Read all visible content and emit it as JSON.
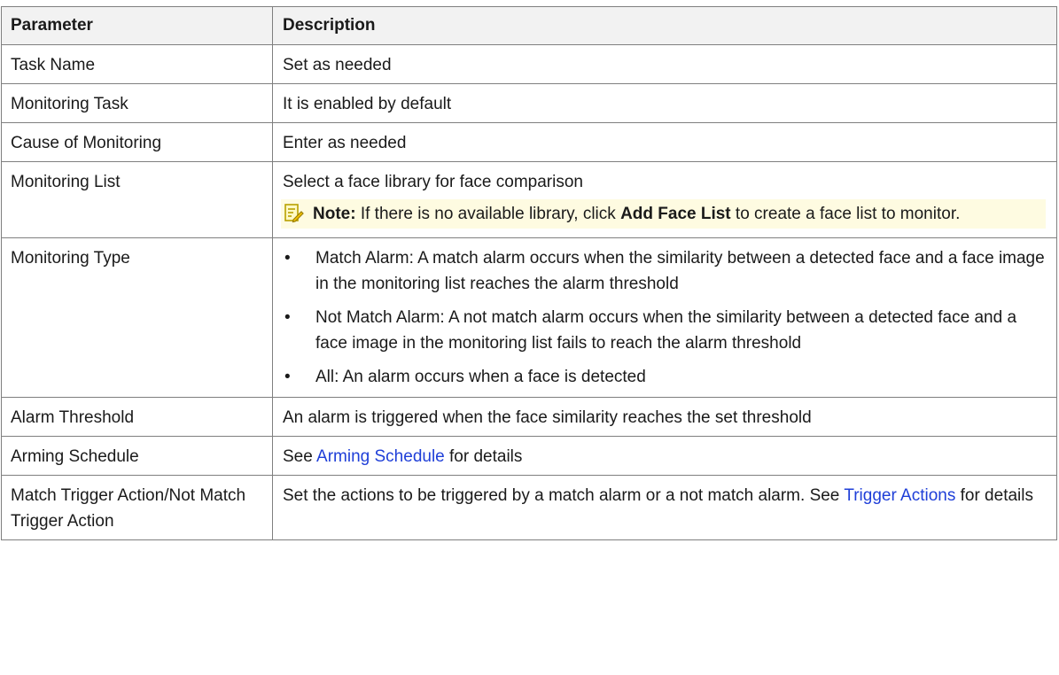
{
  "header": {
    "col1": "Parameter",
    "col2": "Description"
  },
  "rows": [
    {
      "param": "Task Name",
      "desc": "Set as needed"
    },
    {
      "param": "Monitoring Task",
      "desc": "It is enabled by default"
    },
    {
      "param": "Cause of Monitoring",
      "desc": "Enter as needed"
    },
    {
      "param": "Monitoring List",
      "desc": "Select a face library for face comparison",
      "note": {
        "label": "Note:",
        "before": " If there is no available library, click ",
        "bold": "Add Face List",
        "after": " to create a face list to monitor."
      }
    },
    {
      "param": "Monitoring Type",
      "bullets": [
        "Match Alarm: A match alarm occurs when the similarity between a detected face and a face image in the monitoring list reaches the alarm threshold",
        "Not Match Alarm: A not match alarm occurs when the similarity between a detected face and a face image in the monitoring list fails to reach the alarm threshold",
        "All: An alarm occurs when a face is detected"
      ]
    },
    {
      "param": "Alarm Threshold",
      "desc": "An alarm is triggered when the face similarity reaches the set threshold"
    },
    {
      "param": "Arming Schedule",
      "before": "See ",
      "link": "Arming Schedule",
      "after": " for details"
    },
    {
      "param": "Match Trigger Action/Not Match Trigger Action",
      "desc": "Set the actions to be triggered by a match alarm or a not match alarm. See ",
      "link": "Trigger Actions",
      "after": " for details"
    }
  ],
  "bullet_glyph": "•",
  "colors": {
    "header_bg": "#f2f2f2",
    "note_bg": "#fefbe1",
    "link": "#1f3fd8",
    "border": "#7f7f7f"
  },
  "icons": {
    "note": "note-pencil-icon"
  }
}
